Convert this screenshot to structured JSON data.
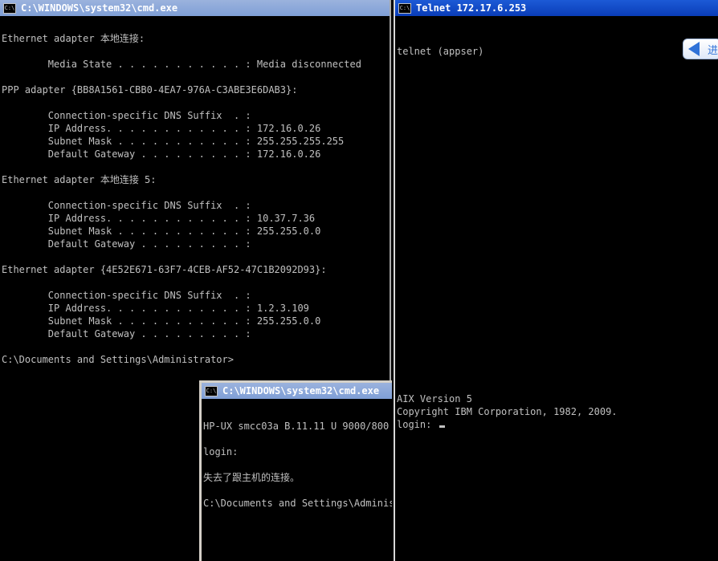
{
  "cmd_window_main": {
    "title": "C:\\WINDOWS\\system32\\cmd.exe",
    "icon": "C:\\",
    "lines": [
      "",
      "Ethernet adapter 本地连接:",
      "",
      "        Media State . . . . . . . . . . . : Media disconnected",
      "",
      "PPP adapter {BB8A1561-CBB0-4EA7-976A-C3ABE3E6DAB3}:",
      "",
      "        Connection-specific DNS Suffix  . :",
      "        IP Address. . . . . . . . . . . . : 172.16.0.26",
      "        Subnet Mask . . . . . . . . . . . : 255.255.255.255",
      "        Default Gateway . . . . . . . . . : 172.16.0.26",
      "",
      "Ethernet adapter 本地连接 5:",
      "",
      "        Connection-specific DNS Suffix  . :",
      "        IP Address. . . . . . . . . . . . : 10.37.7.36",
      "        Subnet Mask . . . . . . . . . . . : 255.255.0.0",
      "        Default Gateway . . . . . . . . . :",
      "",
      "Ethernet adapter {4E52E671-63F7-4CEB-AF52-47C1B2092D93}:",
      "",
      "        Connection-specific DNS Suffix  . :",
      "        IP Address. . . . . . . . . . . . : 1.2.3.109",
      "        Subnet Mask . . . . . . . . . . . : 255.255.0.0",
      "        Default Gateway . . . . . . . . . :",
      "",
      "C:\\Documents and Settings\\Administrator>"
    ]
  },
  "telnet_window": {
    "title": "Telnet 172.17.6.253",
    "icon": "C:\\",
    "upper_lines": [
      "",
      "telnet (appser)"
    ],
    "lower_lines": [
      "AIX Version 5",
      "Copyright IBM Corporation, 1982, 2009."
    ],
    "prompt": "login: ",
    "badge_icon": "arrow-badge-icon",
    "badge_text": "进"
  },
  "cmd_window_small": {
    "title": "C:\\WINDOWS\\system32\\cmd.exe",
    "icon": "C:\\",
    "lines": [
      "",
      "HP-UX smcc03a B.11.11 U 9000/800",
      "",
      "login:",
      "",
      "失去了跟主机的连接。",
      "",
      "C:\\Documents and Settings\\Administrator>"
    ]
  }
}
